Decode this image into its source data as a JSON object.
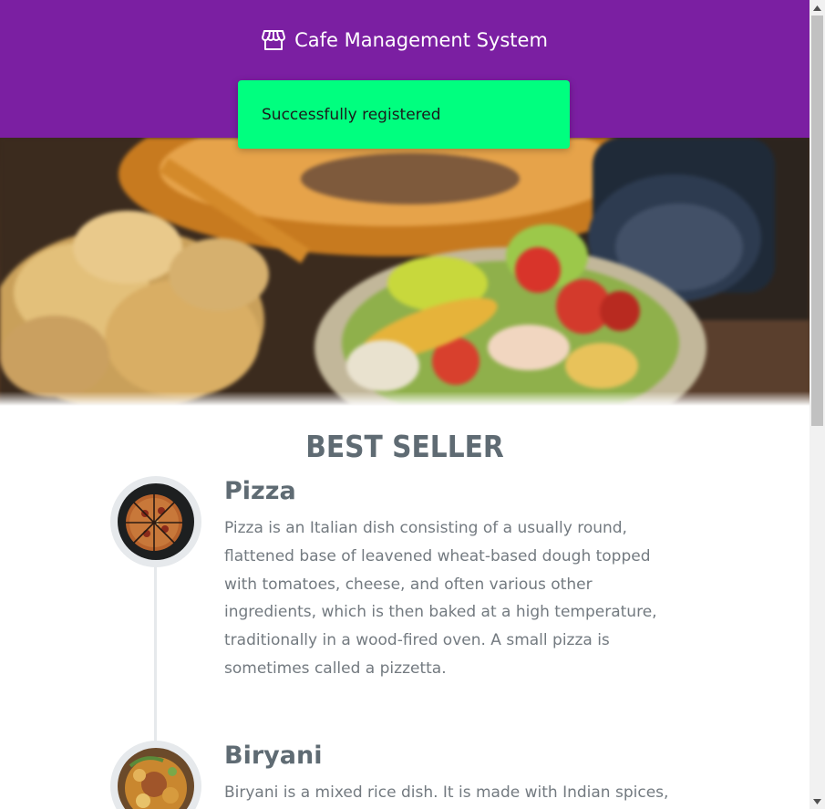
{
  "header": {
    "title": "Cafe Management System",
    "icon": "store-icon",
    "background": "#7b1fa2"
  },
  "toast": {
    "message": "Successfully registered",
    "color": "#00ff7f"
  },
  "best_seller": {
    "heading": "BEST SELLER",
    "items": [
      {
        "title": "Pizza",
        "description": "Pizza is an Italian dish consisting of a usually round, flattened base of leavened wheat-based dough topped with tomatoes, cheese, and often various other ingredients, which is then baked at a high temperature, traditionally in a wood-fired oven. A small pizza is sometimes called a pizzetta."
      },
      {
        "title": "Biryani",
        "description": "Biryani is a mixed rice dish. It is made with Indian spices,"
      }
    ]
  }
}
